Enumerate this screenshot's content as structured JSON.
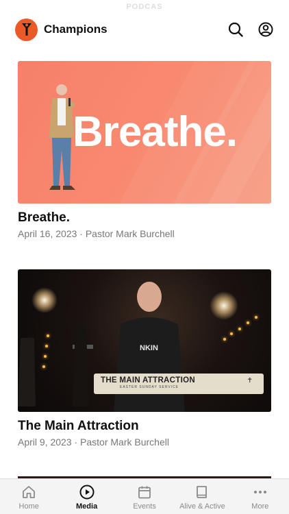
{
  "status_bar": {
    "time": "PODCAS"
  },
  "header": {
    "title": "Champions",
    "accent": "#ea5a28"
  },
  "cards": [
    {
      "thumb_word": "Breathe.",
      "title": "Breathe.",
      "meta": "April 16, 2023 · Pastor Mark Burchell",
      "thumb_color": "#f6806a"
    },
    {
      "banner_title": "THE MAIN ATTRACTION",
      "banner_subtitle": "EASTER SUNDAY SERVICE",
      "title": "The Main Attraction",
      "meta": "April 9, 2023 · Pastor Mark Burchell",
      "thumb_color": "#0b0908"
    }
  ],
  "tabbar": {
    "tabs": [
      {
        "label": "Home",
        "icon": "home-icon",
        "active": false
      },
      {
        "label": "Media",
        "icon": "play-circle-icon",
        "active": true
      },
      {
        "label": "Events",
        "icon": "calendar-icon",
        "active": false
      },
      {
        "label": "Alive & Active",
        "icon": "book-icon",
        "active": false
      },
      {
        "label": "More",
        "icon": "more-dots-icon",
        "active": false
      }
    ]
  }
}
